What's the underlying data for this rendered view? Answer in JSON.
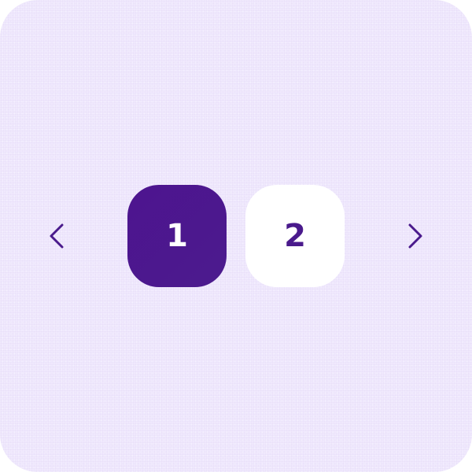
{
  "pagination": {
    "prev_icon": "chevron-left-icon",
    "next_icon": "chevron-right-icon",
    "pages": [
      {
        "label": "1",
        "active": true
      },
      {
        "label": "2",
        "active": false
      }
    ]
  },
  "colors": {
    "background": "#f0e9fd",
    "accent": "#4d148f",
    "active_text": "#ffffff",
    "inactive_bg": "#ffffff",
    "inactive_text": "#4a1a8c"
  }
}
